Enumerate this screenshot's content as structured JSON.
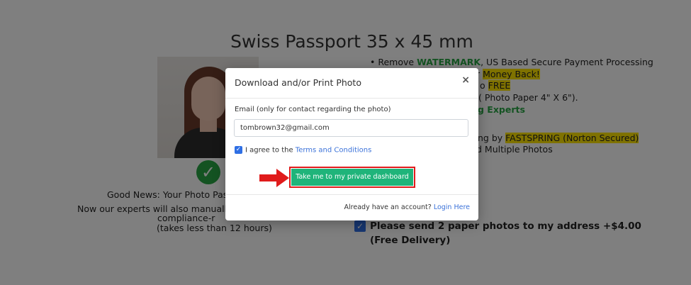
{
  "page": {
    "title": "Swiss Passport 35 x 45 mm",
    "good_news": "Good News: Your Photo Passe",
    "experts_line": "Now our experts will also manually c",
    "compliance": "compliance-r",
    "takes": "(takes less than 12 hours)",
    "bullets": {
      "b1_prefix": "Remove ",
      "b1_green": "WATERMARK",
      "b1_suffix": ", US Based Secure Payment Processing",
      "b2_frag": "r ",
      "b2_hl": "Money Back!",
      "b3_frag": "o ",
      "b3_hl": "FREE",
      "b4_frag": "( Photo Paper 4\" X 6\").",
      "b5_green": "g Experts",
      "b6_frag": "ng by ",
      "b6_hl": "FASTSPRING (Norton Secured)",
      "b7_frag": "d Multiple Photos"
    },
    "paper_option": "Please send 2 paper photos to my address +$4.00 (Free Delivery)",
    "paper_checked": true
  },
  "modal": {
    "title": "Download and/or Print Photo",
    "close": "×",
    "email_label": "Email (only for contact regarding the photo)",
    "email_value": "tombrown32@gmail.com",
    "agree_text": "I agree to the ",
    "terms_link": "Terms and Conditions",
    "agree_checked": true,
    "cta": "Take me to my private dashboard",
    "footer_text": "Already have an account? ",
    "login_link": "Login Here"
  },
  "icons": {
    "checkmark": "✓",
    "arrow": "arrow-right-icon"
  },
  "colors": {
    "cta_bg": "#1fb47a",
    "highlight_border": "#e01b1b",
    "arrow": "#e01b1b",
    "link": "#3b72d9",
    "checkbox": "#2f6fe4",
    "green_text": "#28a745",
    "yellow_highlight": "#ffe400",
    "backdrop": "rgba(0,0,0,0.5)"
  }
}
